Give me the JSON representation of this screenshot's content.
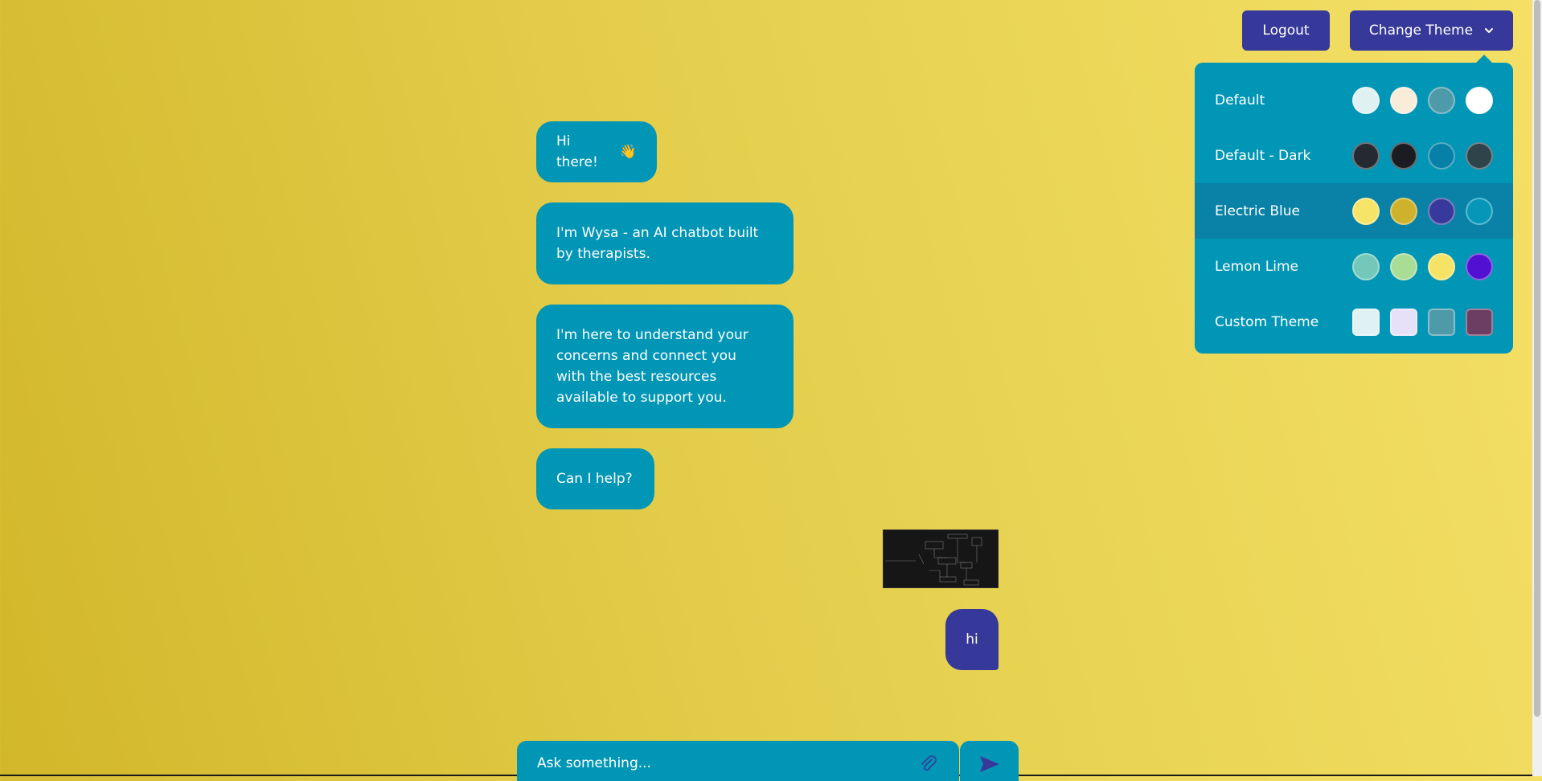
{
  "header": {
    "logout_label": "Logout",
    "change_theme_label": "Change Theme"
  },
  "theme_menu": {
    "items": [
      {
        "label": "Default",
        "swatches": [
          "#dff1f2",
          "#f9ecd9",
          "#4e9aa8",
          "#ffffff"
        ],
        "shape": "circle"
      },
      {
        "label": "Default - Dark",
        "swatches": [
          "#252a32",
          "#1a1c22",
          "#0680a7",
          "#2f434a"
        ],
        "shape": "circle"
      },
      {
        "label": "Electric Blue",
        "swatches": [
          "#f6e468",
          "#ceb22c",
          "#38399b",
          "#0697b8"
        ],
        "shape": "circle",
        "active": true
      },
      {
        "label": "Lemon Lime",
        "swatches": [
          "#73c8ba",
          "#a9dc95",
          "#f6e266",
          "#5211d2"
        ],
        "shape": "circle"
      },
      {
        "label": "Custom Theme",
        "swatches": [
          "#dff1f2",
          "#e7e0f9",
          "#4e9aa8",
          "#6c3e63"
        ],
        "shape": "square"
      }
    ]
  },
  "chat": {
    "bot_messages": [
      {
        "text": "Hi there!",
        "emoji": "👋"
      },
      {
        "lines": [
          "I'm Wysa - an AI chatbot built",
          "by therapists."
        ]
      },
      {
        "lines": [
          "I'm here to understand your",
          "concerns and connect you",
          "with the best resources",
          "available to support you."
        ]
      },
      {
        "text": "Can I help?"
      }
    ],
    "user_message": "hi"
  },
  "composer": {
    "placeholder": "Ask something..."
  },
  "icons": {
    "theme_chevron": "chevron-down-icon",
    "attach": "paperclip-icon",
    "send": "send-icon",
    "wave": "waving-hand-icon"
  },
  "colors": {
    "accent": "#37399a",
    "panel": "#0296b6",
    "active_row": "#0a82a7"
  }
}
